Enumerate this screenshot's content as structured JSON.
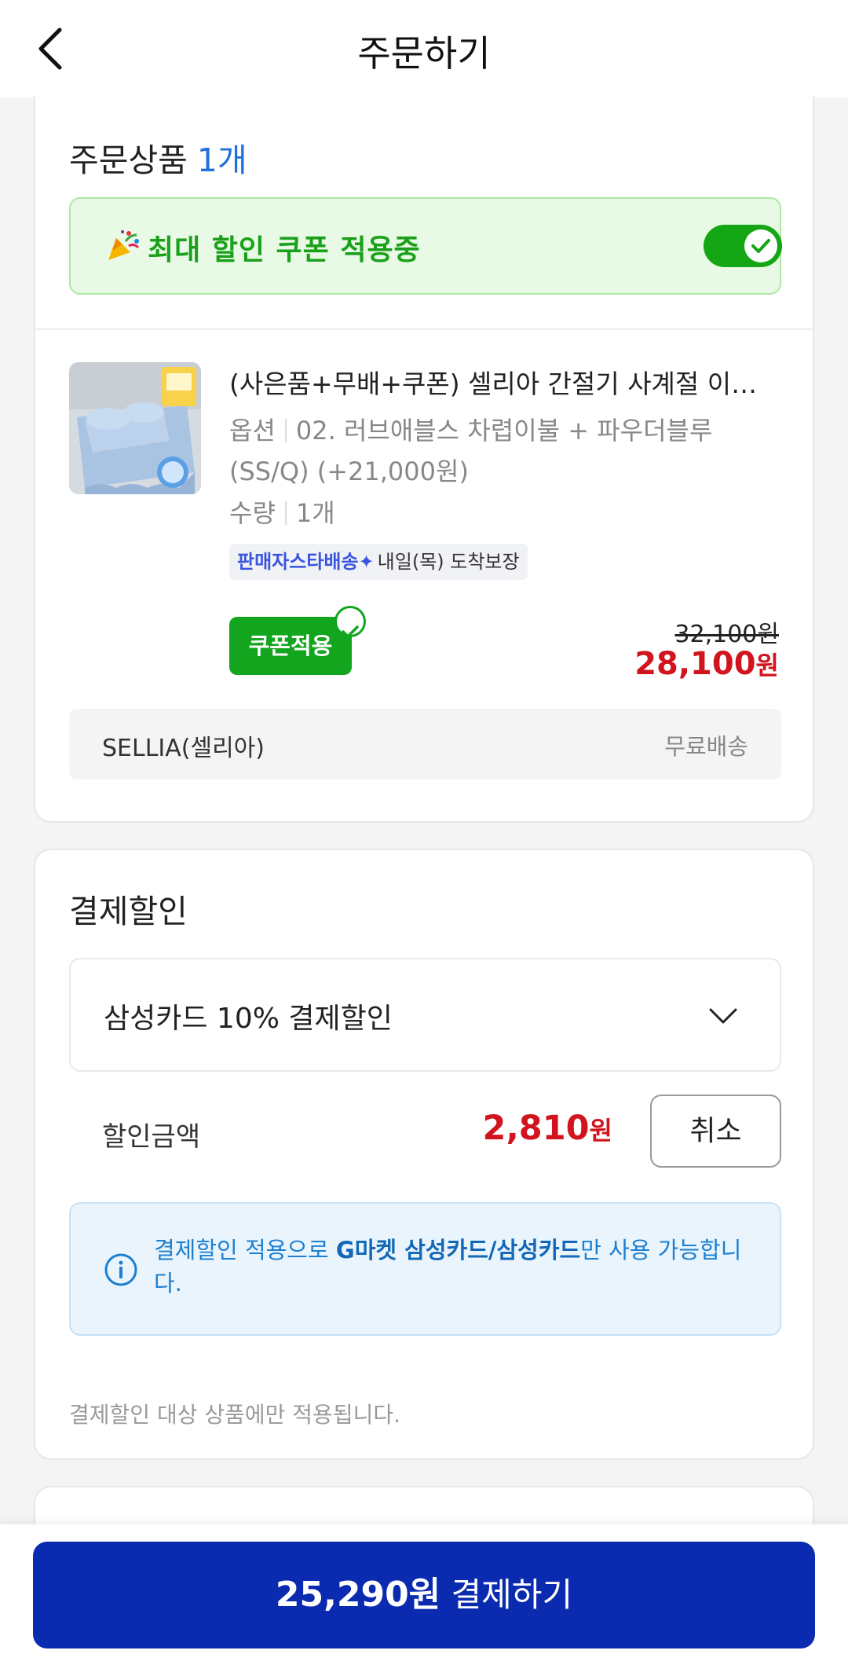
{
  "header": {
    "title": "주문하기",
    "back_icon": "chevron-left-icon"
  },
  "order_section": {
    "title": "주문상품",
    "count": "1개",
    "coupon_banner": {
      "text": "최대 할인 쿠폰 적용중",
      "toggle_on": true,
      "color": "#14a614"
    },
    "product": {
      "name": "(사은품+무배+쿠폰) 셀리아 간절기 사계절 이불...",
      "option_label": "옵션",
      "option_value": "02. 러브애블스 차렵이불 + 파우더블루(SS/Q) (+21,000원)",
      "qty_label": "수량",
      "qty_value": "1개",
      "delivery_brand": "판매자스타배송✦",
      "delivery_info": "내일(목) 도착보장",
      "coupon_button": "쿠폰적용",
      "original_price": "32,100원",
      "sale_price_number": "28,100",
      "sale_price_unit": "원"
    },
    "seller": {
      "name": "SELLIA(셀리아)",
      "shipping": "무료배송"
    }
  },
  "payment_discount": {
    "title": "결제할인",
    "selected_option": "삼성카드 10% 결제할인",
    "amount_label": "할인금액",
    "amount_number": "2,810",
    "amount_unit": "원",
    "cancel_label": "취소",
    "notice_prefix": "결제할인 적용으로 ",
    "notice_bold": "G마켓 삼성카드/삼성카드",
    "notice_suffix": "만 사용 가능합니다.",
    "footnote": "결제할인 대상 상품에만 적용됩니다."
  },
  "checkout": {
    "amount": "25,290원",
    "label": "결제하기",
    "color": "#0a2bb0"
  }
}
